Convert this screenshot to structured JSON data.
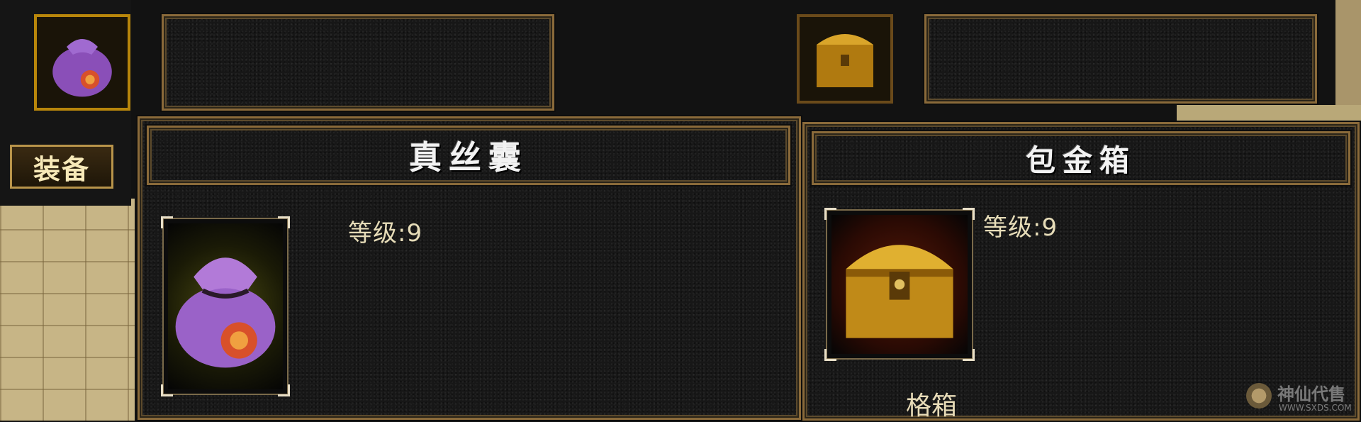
{
  "left_panel": {
    "item_name": "真丝囊",
    "level_label": "等级:9",
    "equip_tab": "装备"
  },
  "right_panel": {
    "item_name": "包金箱",
    "level_label": "等级:9",
    "bottom_label": "格箱"
  },
  "watermark": {
    "title": "神仙代售",
    "url": "WWW.SXDS.COM"
  },
  "icons": {
    "left_slot": "silk-pouch-icon",
    "right_slot": "gold-chest-icon"
  },
  "colors": {
    "gold_border": "#b8860b",
    "panel_border": "#8a6a3a",
    "title_text": "#f2f2f2",
    "level_text": "#e6dcb8"
  }
}
